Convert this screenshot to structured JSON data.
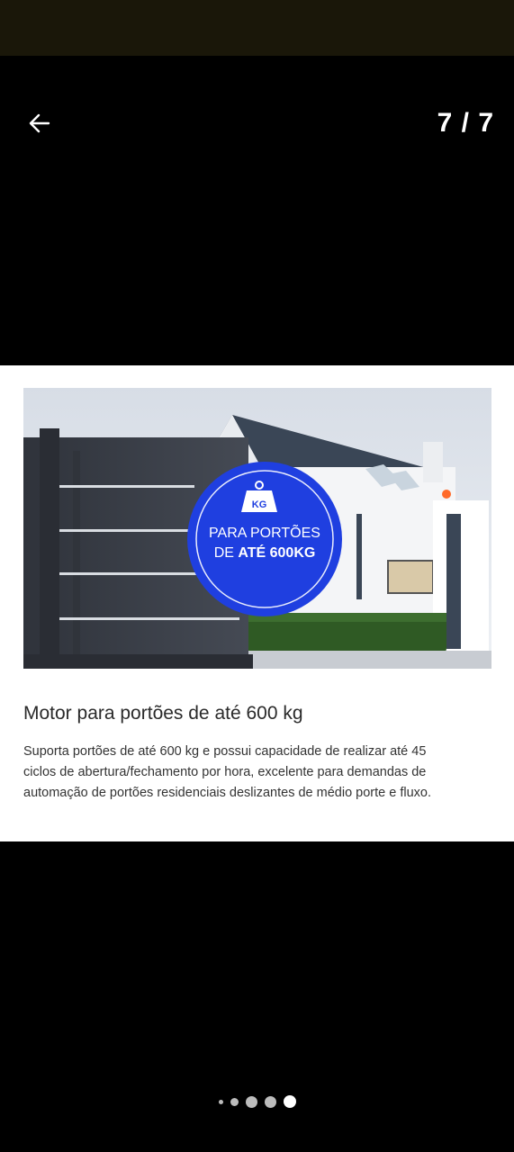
{
  "header": {
    "counter": "7 / 7"
  },
  "card": {
    "badge": {
      "icon_label": "KG",
      "line1": "PARA PORTÕES",
      "line2_prefix": "DE ",
      "line2_bold": "ATÉ 600KG"
    },
    "title": "Motor para portões de até 600 kg",
    "description": "Suporta portões de até 600 kg e possui capacidade de realizar até 45 ciclos de abertura/fechamento por hora, excelente para demandas de automação de portões residenciais deslizantes de médio porte e fluxo."
  },
  "pagination": {
    "total": 5,
    "active_index": 4
  },
  "colors": {
    "badge_blue": "#1f3fe0",
    "gate": "#3b3f48",
    "roof": "#3a4656",
    "house_wall": "#f4f5f7",
    "hedge": "#2f5a24"
  }
}
